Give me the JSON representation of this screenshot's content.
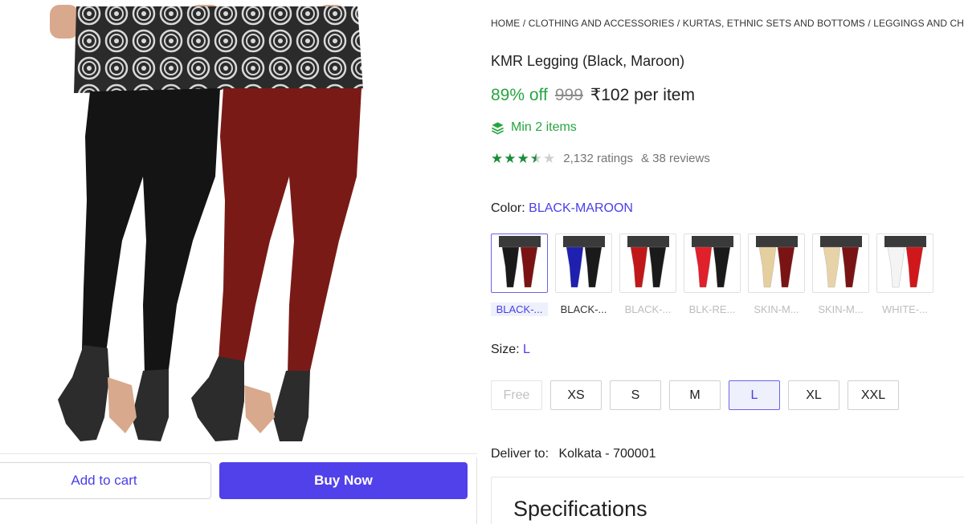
{
  "buttons": {
    "add_to_cart": "Add to cart",
    "buy_now": "Buy Now"
  },
  "breadcrumb": {
    "text": "HOME / CLOTHING AND ACCESSORIES / KURTAS, ETHNIC SETS AND BOTTOMS / LEGGINGS AND CHURIDARS"
  },
  "product": {
    "title": "KMR Legging (Black, Maroon)",
    "discount": "89% off",
    "mrp": "999",
    "price": "₹102 per item",
    "min_items": "Min 2 items",
    "rating_value": 3.5,
    "ratings_count": "2,132 ratings",
    "reviews_count": "& 38 reviews"
  },
  "color": {
    "label": "Color:",
    "selected": "BLACK-MAROON",
    "options": [
      {
        "name": "BLACK-...",
        "left": "#1a1a1a",
        "right": "#7a1414"
      },
      {
        "name": "BLACK-...",
        "left": "#1f1fb0",
        "right": "#1a1a1a"
      },
      {
        "name": "BLACK-...",
        "left": "#c01818",
        "right": "#1a1a1a"
      },
      {
        "name": "BLK-RE...",
        "left": "#e0202a",
        "right": "#1a1a1a"
      },
      {
        "name": "SKIN-M...",
        "left": "#e6cf9e",
        "right": "#7a1414"
      },
      {
        "name": "SKIN-M...",
        "left": "#e8d3a8",
        "right": "#7a1414"
      },
      {
        "name": "WHITE-...",
        "left": "#f4f4f4",
        "right": "#d0181c"
      }
    ]
  },
  "size": {
    "label": "Size:",
    "selected": "L",
    "options": [
      "Free",
      "XS",
      "S",
      "M",
      "L",
      "XL",
      "XXL"
    ]
  },
  "delivery": {
    "label": "Deliver to:",
    "location": "Kolkata - 700001"
  },
  "specs": {
    "title": "Specifications"
  },
  "colors": {
    "accent": "#5141ea",
    "discount_green": "#26a541",
    "star_green": "#1b8c3a"
  }
}
